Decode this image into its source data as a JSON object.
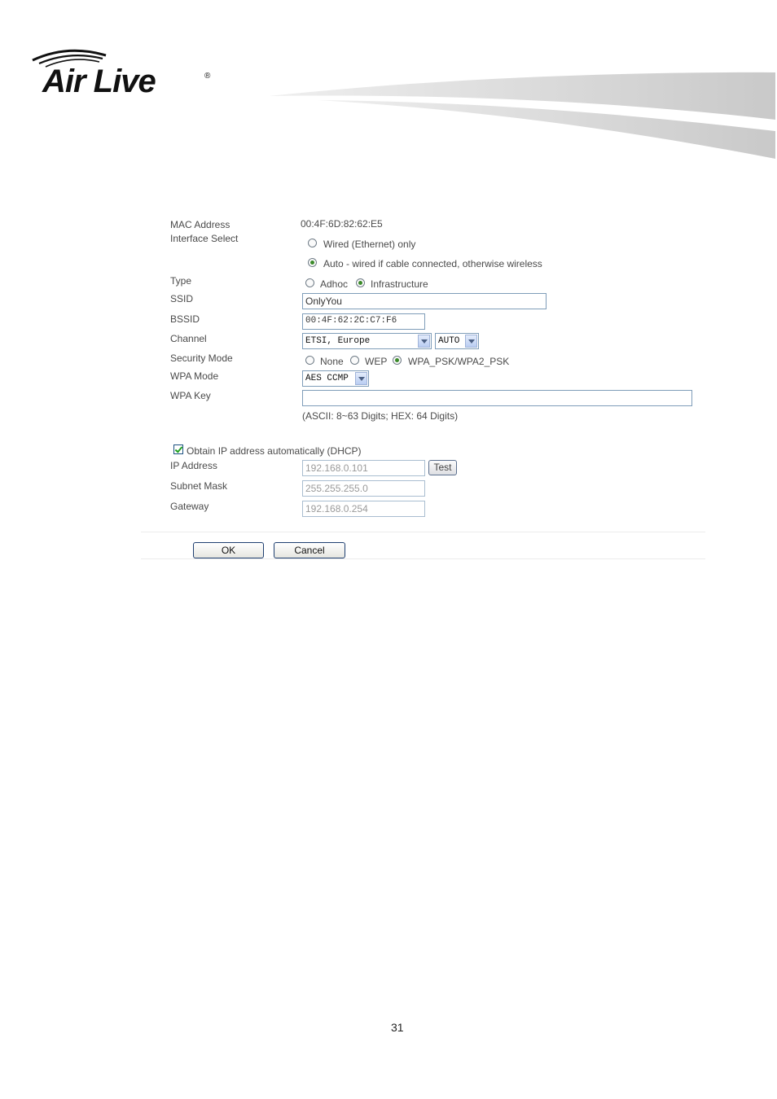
{
  "brand": {
    "name": "Air Live",
    "registered": "®"
  },
  "form": {
    "mac": {
      "label": "MAC Address",
      "value": "00:4F:6D:82:62:E5"
    },
    "interface": {
      "label": "Interface Select",
      "options": [
        {
          "label": "Wired (Ethernet) only",
          "checked": false
        },
        {
          "label": "Auto - wired if cable connected, otherwise wireless",
          "checked": true
        }
      ]
    },
    "type": {
      "label": "Type",
      "options": [
        {
          "label": "Adhoc",
          "checked": false
        },
        {
          "label": "Infrastructure",
          "checked": true
        }
      ]
    },
    "ssid": {
      "label": "SSID",
      "value": "OnlyYou"
    },
    "bssid": {
      "label": "BSSID",
      "value": "00:4F:62:2C:C7:F6"
    },
    "channel": {
      "label": "Channel",
      "region": "ETSI, Europe",
      "channel": "AUTO"
    },
    "security": {
      "label": "Security Mode",
      "options": [
        {
          "label": "None",
          "checked": false
        },
        {
          "label": "WEP",
          "checked": false
        },
        {
          "label": "WPA_PSK/WPA2_PSK",
          "checked": true
        }
      ]
    },
    "wpa_mode": {
      "label": "WPA Mode",
      "value": "AES CCMP"
    },
    "wpa_key": {
      "label": "WPA Key",
      "value": "",
      "hint": "(ASCII: 8~63 Digits; HEX: 64 Digits)"
    },
    "dhcp": {
      "label": "Obtain IP address automatically (DHCP)",
      "checked": true
    },
    "ip": {
      "label": "IP Address",
      "value": "192.168.0.101",
      "test_label": "Test"
    },
    "subnet": {
      "label": "Subnet Mask",
      "value": "255.255.255.0"
    },
    "gateway": {
      "label": "Gateway",
      "value": "192.168.0.254"
    }
  },
  "buttons": {
    "ok": "OK",
    "cancel": "Cancel"
  },
  "page_number": "31"
}
